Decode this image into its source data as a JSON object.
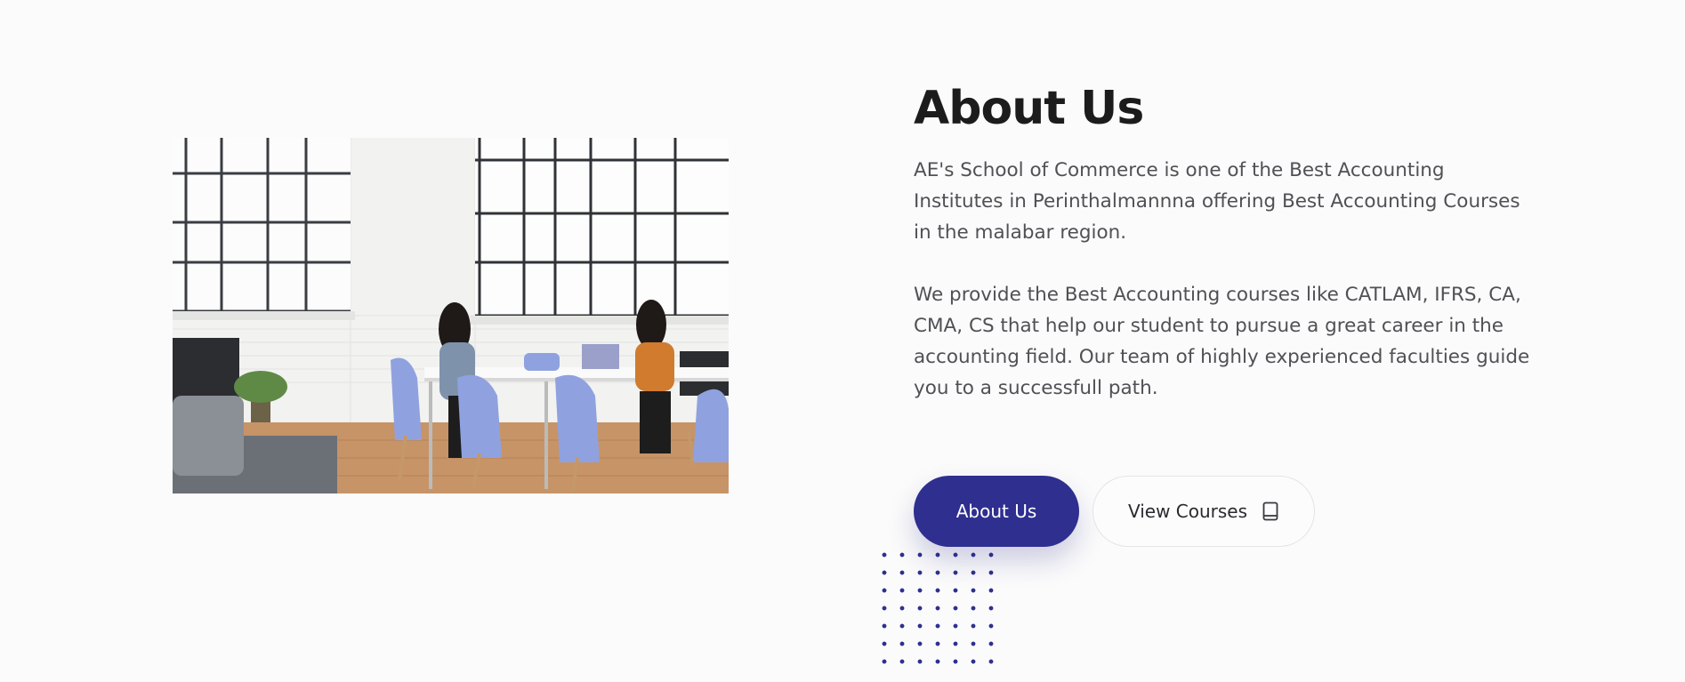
{
  "about": {
    "title": "About Us",
    "paragraph_1": "AE's School of Commerce is one of the Best Accounting Institutes in Perinthalmannna offering Best Accounting Courses in the malabar region.",
    "paragraph_2": "We provide the Best Accounting courses like CATLAM, IFRS, CA, CMA, CS that help our student to pursue a great career in the accounting field. Our team of highly experienced faculties guide you to a successfull path."
  },
  "buttons": {
    "about_label": "About Us",
    "courses_label": "View Courses",
    "courses_icon": "book-icon"
  },
  "colors": {
    "accent": "#2e2f8f",
    "background": "#fbfbfb",
    "title": "#1c1c1c",
    "body_text": "#505055"
  }
}
